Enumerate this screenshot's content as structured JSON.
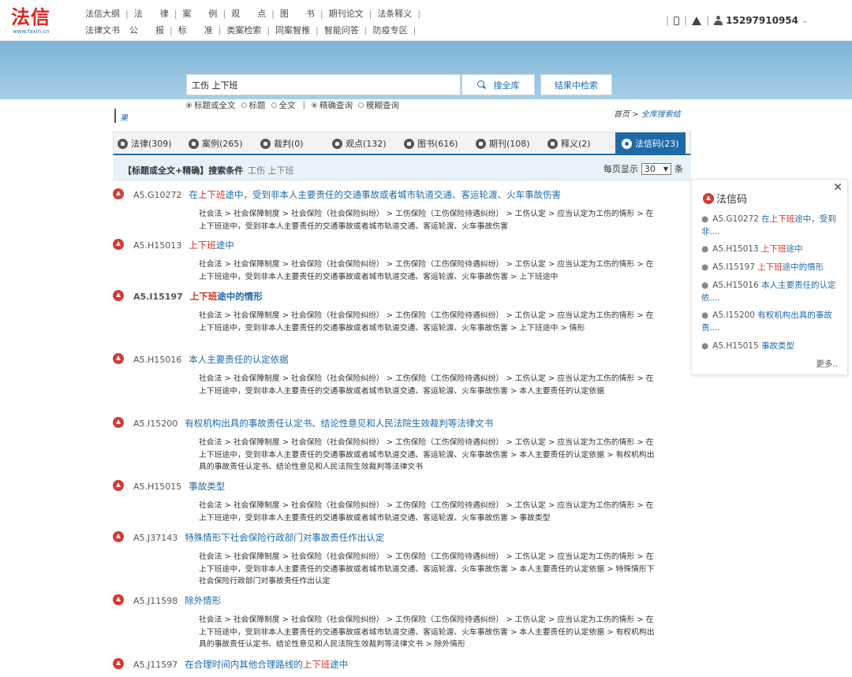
{
  "logo": {
    "text": "法信",
    "sub": "www.faxin.cn"
  },
  "nav_row1": [
    "法信大纲",
    "法　　律",
    "案　　例",
    "观　　点",
    "图　　书",
    "期刊论文",
    "法条释义"
  ],
  "nav_row2": [
    "法律文书",
    "公　　报",
    "标　　准",
    "类案检索",
    "同案智推",
    "智能问答",
    "防疫专区"
  ],
  "user": {
    "phone": "15297910954"
  },
  "search": {
    "query": "工伤 上下班",
    "search_all_label": "搜全库",
    "within_label": "结果中检索"
  },
  "options": {
    "opt1": "标题或全文",
    "opt2": "标题",
    "opt3": "全文",
    "opt4": "精确查询",
    "opt5": "模糊查询"
  },
  "left_mark": "果",
  "breadcrumb": {
    "home": "首页",
    "sep": ">",
    "current": "全库搜索结"
  },
  "tabs": [
    {
      "label": "法律(309)"
    },
    {
      "label": "案例(265)"
    },
    {
      "label": "裁判(0)"
    },
    {
      "label": "观点(132)"
    },
    {
      "label": "图书(616)"
    },
    {
      "label": "期刊(108)"
    },
    {
      "label": "释义(2)"
    },
    {
      "label": "法信码(23)"
    }
  ],
  "condition": {
    "label": "【标题或全文+精确】搜索条件",
    "value": "工伤 上下班",
    "per_page_prefix": "每页显示",
    "per_page_value": "30",
    "per_page_suffix": "条"
  },
  "results": [
    {
      "code": "A5.G10272",
      "title_pre": "在",
      "title_hl": "上下班",
      "title_post": "途中，受到非本人主要责任的交通事故或者城市轨道交通、客运轮渡、火车事故伤害",
      "path": "社会法 > 社会保障制度 > 社会保险（社会保险纠纷） > 工伤保险（工伤保险待遇纠纷） > 工伤认定 > 应当认定为工伤的情形 > 在上下班途中，受到非本人主要责任的交通事故或者城市轨道交通、客运轮渡、火车事故伤害"
    },
    {
      "code": "A5.H15013",
      "title_pre": "",
      "title_hl": "上下班",
      "title_post": "途中",
      "path": "社会法 > 社会保障制度 > 社会保险（社会保险纠纷） > 工伤保险（工伤保险待遇纠纷） > 工伤认定 > 应当认定为工伤的情形 > 在上下班途中，受到非本人主要责任的交通事故或者城市轨道交通、客运轮渡、火车事故伤害 > 上下班途中"
    },
    {
      "code": "A5.I15197",
      "title_pre": "",
      "title_hl": "上下班",
      "title_post": "途中的情形",
      "path": "社会法 > 社会保障制度 > 社会保险（社会保险纠纷） > 工伤保险（工伤保险待遇纠纷） > 工伤认定 > 应当认定为工伤的情形 > 在上下班途中，受到非本人主要责任的交通事故或者城市轨道交通、客运轮渡、火车事故伤害 > 上下班途中 > 情形"
    },
    {
      "code": "A5.H15016",
      "title_pre": "本人主要责任的认定依据",
      "title_hl": "",
      "title_post": "",
      "path": "社会法 > 社会保障制度 > 社会保险（社会保险纠纷） > 工伤保险（工伤保险待遇纠纷） > 工伤认定 > 应当认定为工伤的情形 > 在上下班途中，受到非本人主要责任的交通事故或者城市轨道交通、客运轮渡、火车事故伤害 > 本人主要责任的认定依据"
    },
    {
      "code": "A5.I15200",
      "title_pre": "有权机构出具的事故责任认定书、结论性意见和人民法院生效裁判等法律文书",
      "title_hl": "",
      "title_post": "",
      "path": "社会法 > 社会保障制度 > 社会保险（社会保险纠纷） > 工伤保险（工伤保险待遇纠纷） > 工伤认定 > 应当认定为工伤的情形 > 在上下班途中，受到非本人主要责任的交通事故或者城市轨道交通、客运轮渡、火车事故伤害 > 本人主要责任的认定依据 > 有权机构出具的事故责任认定书、结论性意见和人民法院生效裁判等法律文书"
    },
    {
      "code": "A5.H15015",
      "title_pre": "事故类型",
      "title_hl": "",
      "title_post": "",
      "path": "社会法 > 社会保障制度 > 社会保险（社会保险纠纷） > 工伤保险（工伤保险待遇纠纷） > 工伤认定 > 应当认定为工伤的情形 > 在上下班途中，受到非本人主要责任的交通事故或者城市轨道交通、客运轮渡、火车事故伤害 > 事故类型"
    },
    {
      "code": "A5.J37143",
      "title_pre": "特殊情形下社会保险行政部门对事故责任作出认定",
      "title_hl": "",
      "title_post": "",
      "path": "社会法 > 社会保障制度 > 社会保险（社会保险纠纷） > 工伤保险（工伤保险待遇纠纷） > 工伤认定 > 应当认定为工伤的情形 > 在上下班途中，受到非本人主要责任的交通事故或者城市轨道交通、客运轮渡、火车事故伤害 > 本人主要责任的认定依据 > 特殊情形下社会保险行政部门对事故责任作出认定"
    },
    {
      "code": "A5.J11598",
      "title_pre": "除外情形",
      "title_hl": "",
      "title_post": "",
      "path": "社会法 > 社会保障制度 > 社会保险（社会保险纠纷） > 工伤保险（工伤保险待遇纠纷） > 工伤认定 > 应当认定为工伤的情形 > 在上下班途中，受到非本人主要责任的交通事故或者城市轨道交通、客运轮渡、火车事故伤害 > 本人主要责任的认定依据 > 有权机构出具的事故责任认定书、结论性意见和人民法院生效裁判等法律文书 > 除外情形"
    },
    {
      "code": "A5.J11597",
      "title_pre": "在合理时间内其他合理路线的",
      "title_hl": "上下班",
      "title_post": "途中",
      "path": ""
    }
  ],
  "side": {
    "title": "法信码",
    "items": [
      {
        "code": "A5.G10272",
        "pre": "在",
        "hl": "上下班",
        "post": "途中，受到非...."
      },
      {
        "code": "A5.H15013",
        "pre": "",
        "hl": "上下班",
        "post": "途中"
      },
      {
        "code": "A5.I15197",
        "pre": "",
        "hl": "上下班",
        "post": "途中的情形"
      },
      {
        "code": "A5.H15016",
        "pre": "本人主要责任的认定依....",
        "hl": "",
        "post": ""
      },
      {
        "code": "A5.I15200",
        "pre": "有权机构出具的事故责....",
        "hl": "",
        "post": ""
      },
      {
        "code": "A5.H15015",
        "pre": "事故类型",
        "hl": "",
        "post": ""
      }
    ],
    "more": "更多.."
  }
}
